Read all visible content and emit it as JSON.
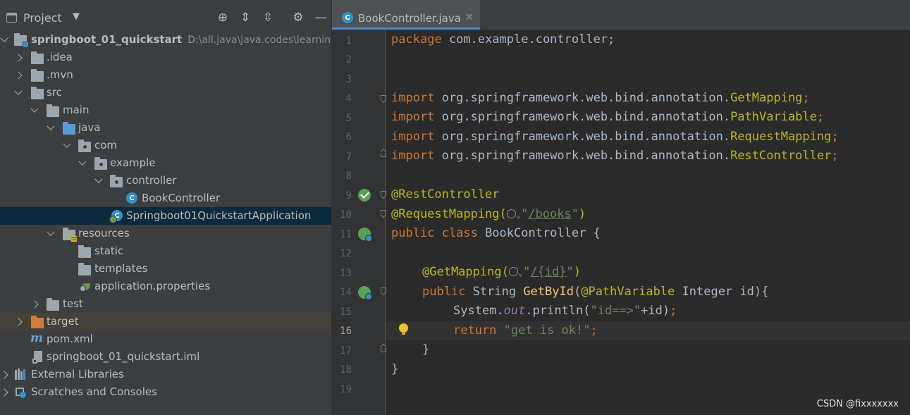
{
  "project_pane": {
    "title": "Project",
    "caret": "▼",
    "tree": [
      {
        "label": "springboot_01_quickstart",
        "hint": "D:\\all.java\\java.codes\\learning\\s",
        "bold": true
      },
      {
        "label": ".idea"
      },
      {
        "label": ".mvn"
      },
      {
        "label": "src"
      },
      {
        "label": "main"
      },
      {
        "label": "java"
      },
      {
        "label": "com"
      },
      {
        "label": "example"
      },
      {
        "label": "controller"
      },
      {
        "label": "BookController"
      },
      {
        "label": "Springboot01QuickstartApplication",
        "selected": true
      },
      {
        "label": "resources"
      },
      {
        "label": "static"
      },
      {
        "label": "templates"
      },
      {
        "label": "application.properties"
      },
      {
        "label": "test"
      },
      {
        "label": "target"
      },
      {
        "label": "pom.xml"
      },
      {
        "label": "springboot_01_quickstart.iml"
      },
      {
        "label": "External Libraries"
      },
      {
        "label": "Scratches and Consoles"
      }
    ]
  },
  "editor": {
    "tab": {
      "label": "BookController.java",
      "close": "×",
      "icon_letter": "C"
    },
    "current_line": 16,
    "line_numbers": [
      "1",
      "2",
      "3",
      "4",
      "5",
      "6",
      "7",
      "8",
      "9",
      "10",
      "11",
      "12",
      "13",
      "14",
      "15",
      "16",
      "17",
      "18",
      "19"
    ],
    "code": {
      "l1_kw": "package",
      "l1_rest": " com.example.controller;",
      "import_kw": "import",
      "l4_pkg": " org.springframework.web.bind.annotation.",
      "l4_cls": "GetMapping",
      "semi": ";",
      "l5_cls": "PathVariable",
      "l6_cls": "RequestMapping",
      "l7_cls": "RestController",
      "l9_ann": "@RestController",
      "l10_ann": "@RequestMapping(",
      "l10_str_q1": "\"",
      "l10_str": "/books",
      "l10_str_q2": "\"",
      "close_paren": ")",
      "l11_kw": "public class",
      "l11_rest": " BookController {",
      "l13_ann": "@GetMapping(",
      "l13_str": "/{id}",
      "l14_kw": "public",
      "l14_type": " String ",
      "l14_fn": "GetById",
      "l14_p1": "(",
      "l14_ann": "@PathVariable",
      "l14_rest": " Integer id){",
      "l15_a": "System.",
      "l15_field": "out",
      "l15_b": ".println(",
      "l15_str": "\"id==>\"",
      "l15_c": "+id)",
      "l16_kw": "return",
      "l16_str": " \"get is ok!\"",
      "l17": "}",
      "l18": "}"
    }
  },
  "watermark": "CSDN @fixxxxxxx"
}
